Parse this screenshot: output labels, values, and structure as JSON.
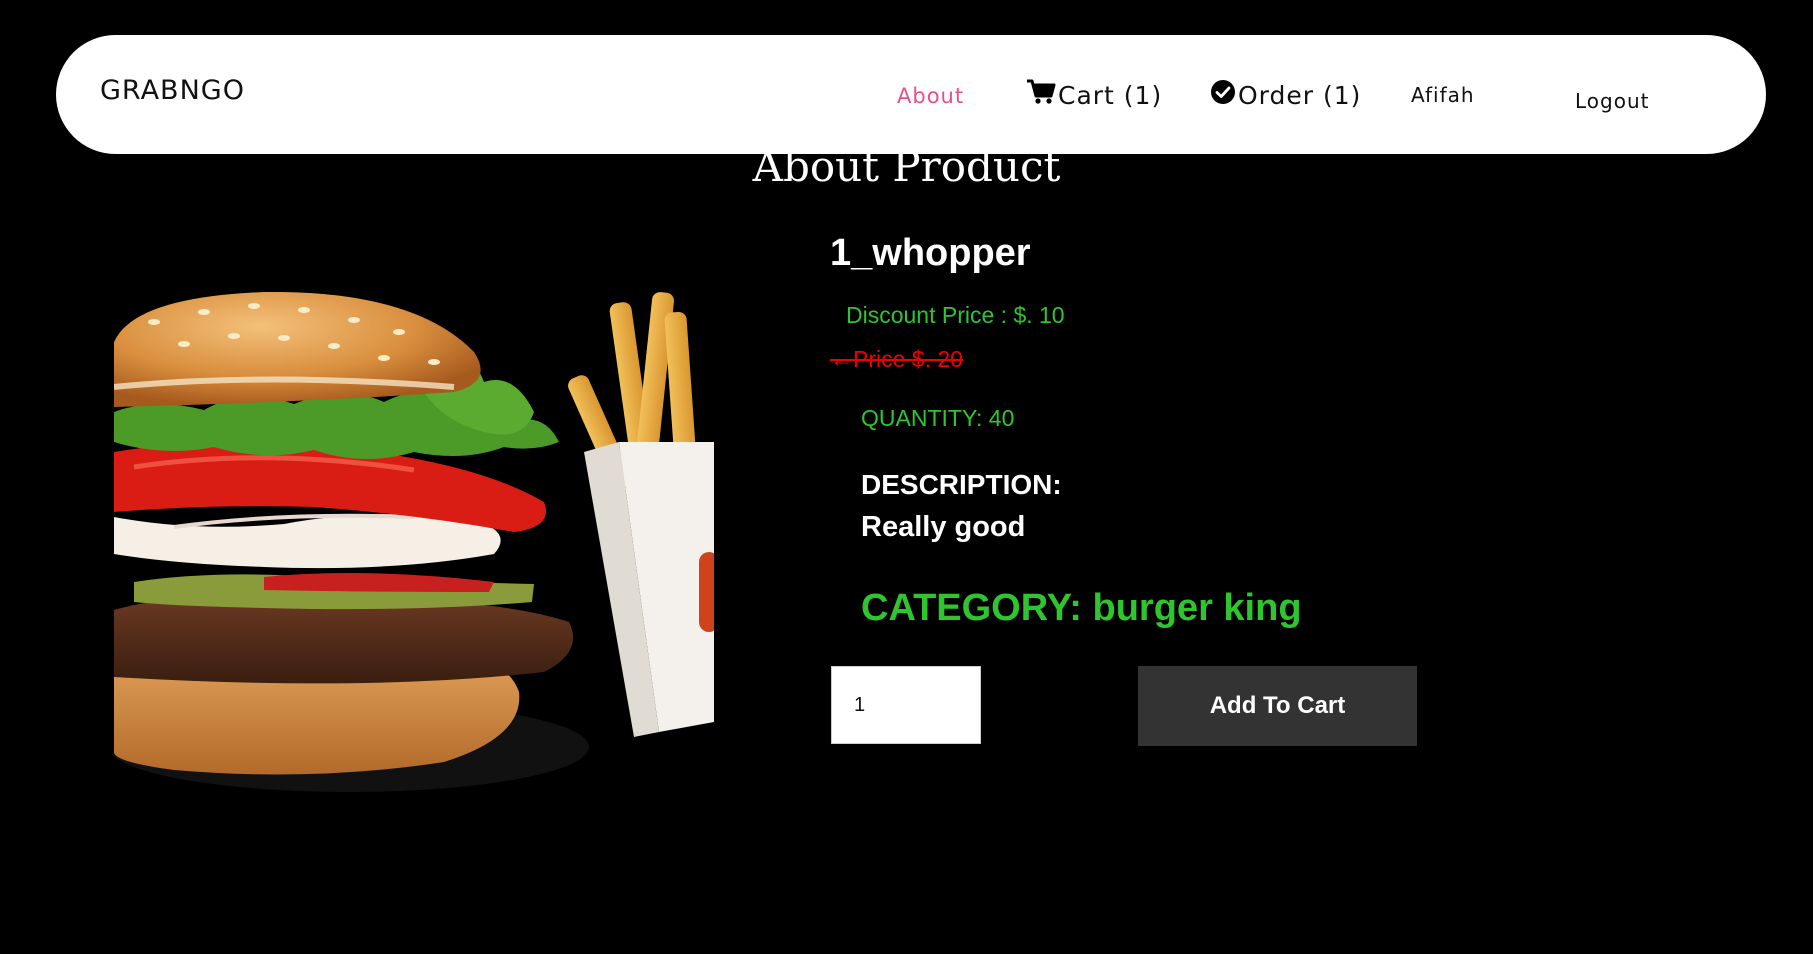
{
  "nav": {
    "brand": "GRABNGO",
    "about_label": "About",
    "cart_label": "Cart (1)",
    "order_label": "Order (1)",
    "user_label": "Afifah",
    "logout_label": "Logout",
    "about_color": "#e8508c"
  },
  "page": {
    "title": "About Product"
  },
  "product": {
    "name": "1_whopper",
    "discount_price": "Discount Price : $. 10",
    "old_price": "Price $. 20",
    "quantity": "QUANTITY: 40",
    "description_label": "DESCRIPTION:",
    "description": "Really good",
    "category": "CATEGORY: burger king",
    "image_alt": "Whopper burger with fries"
  },
  "actions": {
    "quantity_value": "1",
    "add_to_cart_label": "Add To Cart"
  },
  "colors": {
    "accent_green": "#2ec52e",
    "old_price_red": "#ee0000",
    "button_bg": "#333333"
  }
}
